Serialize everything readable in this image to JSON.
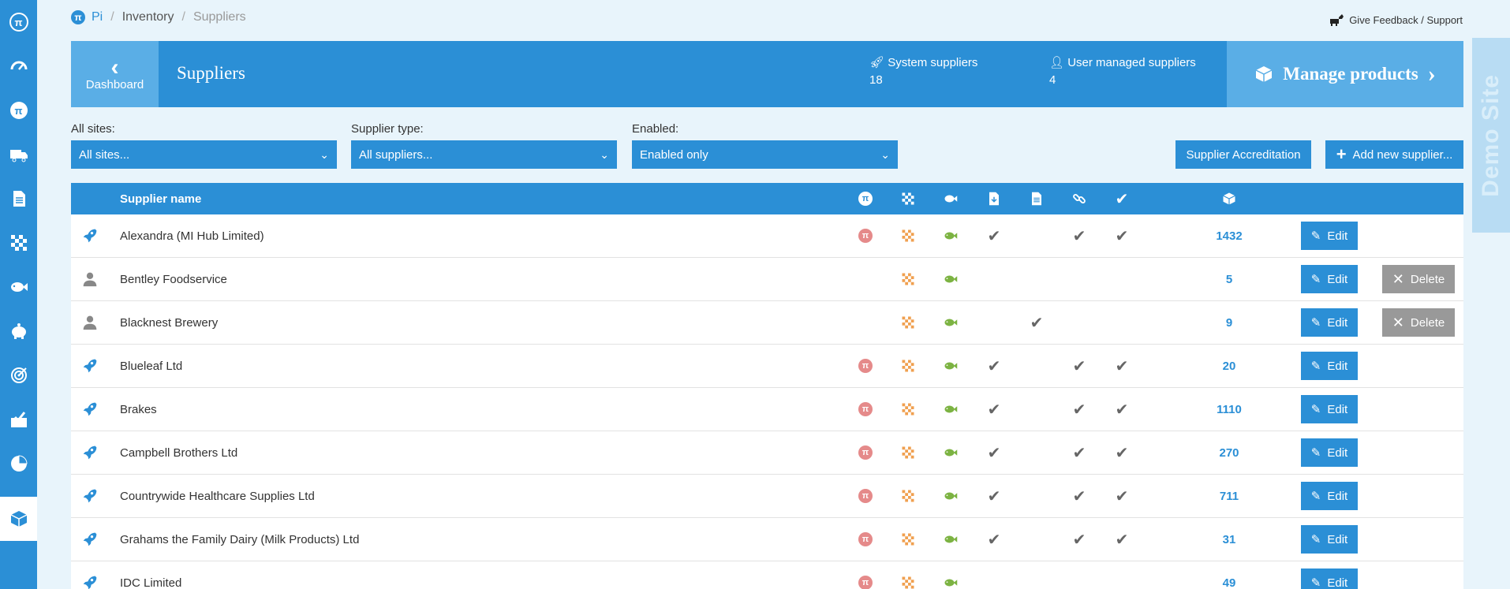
{
  "sidebar": {
    "items": [
      {
        "icon": "pi-logo-icon"
      },
      {
        "icon": "gauge-icon"
      },
      {
        "icon": "apple-pi-icon"
      },
      {
        "icon": "truck-icon"
      },
      {
        "icon": "document-icon"
      },
      {
        "icon": "checkerboard-icon"
      },
      {
        "icon": "fish-icon"
      },
      {
        "icon": "piggy-bank-icon"
      },
      {
        "icon": "target-icon"
      },
      {
        "icon": "checkbox-tray-icon"
      },
      {
        "icon": "pie-chart-icon"
      },
      {
        "icon": "box-icon",
        "active": true
      }
    ]
  },
  "breadcrumb": {
    "root": "Pi",
    "middle": "Inventory",
    "current": "Suppliers"
  },
  "feedback": {
    "label": "Give Feedback / Support"
  },
  "header": {
    "back_label": "Dashboard",
    "title": "Suppliers",
    "system_label": "System suppliers",
    "system_count": "18",
    "user_label": "User managed suppliers",
    "user_count": "4",
    "manage_label": "Manage products"
  },
  "demo_label": "Demo Site",
  "filters": {
    "sites": {
      "label": "All sites:",
      "value": "All sites..."
    },
    "type": {
      "label": "Supplier type:",
      "value": "All suppliers..."
    },
    "enabled": {
      "label": "Enabled:",
      "value": "Enabled only"
    }
  },
  "buttons": {
    "accreditation": "Supplier Accreditation",
    "add": "Add new supplier..."
  },
  "table": {
    "header_name": "Supplier name",
    "edit_label": "Edit",
    "delete_label": "Delete",
    "rows": [
      {
        "type": "system",
        "name": "Alexandra (MI Hub Limited)",
        "pi": true,
        "check1": true,
        "check2": false,
        "check3": true,
        "check4": true,
        "count": "1432",
        "deletable": false
      },
      {
        "type": "user",
        "name": "Bentley Foodservice",
        "pi": false,
        "check1": false,
        "check2": false,
        "check3": false,
        "check4": false,
        "count": "5",
        "deletable": true
      },
      {
        "type": "user",
        "name": "Blacknest Brewery",
        "pi": false,
        "check1": false,
        "check2": true,
        "check3": false,
        "check4": false,
        "count": "9",
        "deletable": true
      },
      {
        "type": "system",
        "name": "Blueleaf Ltd",
        "pi": true,
        "check1": true,
        "check2": false,
        "check3": true,
        "check4": true,
        "count": "20",
        "deletable": false
      },
      {
        "type": "system",
        "name": "Brakes",
        "pi": true,
        "check1": true,
        "check2": false,
        "check3": true,
        "check4": true,
        "count": "1110",
        "deletable": false
      },
      {
        "type": "system",
        "name": "Campbell Brothers Ltd",
        "pi": true,
        "check1": true,
        "check2": false,
        "check3": true,
        "check4": true,
        "count": "270",
        "deletable": false
      },
      {
        "type": "system",
        "name": "Countrywide Healthcare Supplies Ltd",
        "pi": true,
        "check1": true,
        "check2": false,
        "check3": true,
        "check4": true,
        "count": "711",
        "deletable": false
      },
      {
        "type": "system",
        "name": "Grahams the Family Dairy (Milk Products) Ltd",
        "pi": true,
        "check1": true,
        "check2": false,
        "check3": true,
        "check4": true,
        "count": "31",
        "deletable": false
      },
      {
        "type": "system",
        "name": "IDC Limited",
        "pi": true,
        "check1": false,
        "check2": false,
        "check3": false,
        "check4": false,
        "count": "49",
        "deletable": false
      }
    ]
  }
}
